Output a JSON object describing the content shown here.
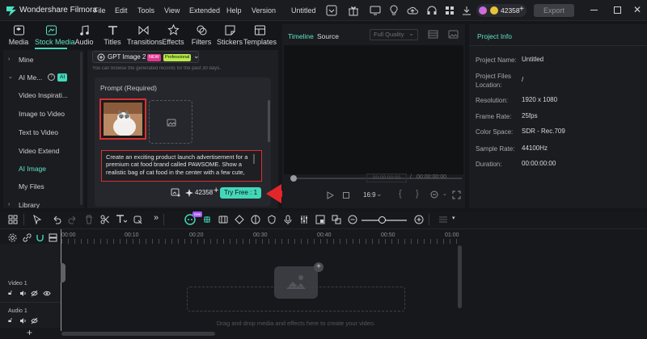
{
  "titlebar": {
    "app_name": "Wondershare Filmora",
    "menu": [
      "File",
      "Edit",
      "Tools",
      "View",
      "Extended",
      "Help",
      "Version"
    ],
    "project_title": "Untitled",
    "credits": "42358",
    "export_label": "Export"
  },
  "toolbar": {
    "items": [
      {
        "label": "Media",
        "icon": "media-icon"
      },
      {
        "label": "Stock Media",
        "icon": "stock-media-icon"
      },
      {
        "label": "Audio",
        "icon": "audio-icon"
      },
      {
        "label": "Titles",
        "icon": "titles-icon"
      },
      {
        "label": "Transitions",
        "icon": "transitions-icon"
      },
      {
        "label": "Effects",
        "icon": "effects-icon"
      },
      {
        "label": "Filters",
        "icon": "filters-icon"
      },
      {
        "label": "Stickers",
        "icon": "stickers-icon"
      },
      {
        "label": "Templates",
        "icon": "templates-icon"
      }
    ]
  },
  "sidebar": {
    "items": [
      {
        "label": "Mine"
      },
      {
        "label": "AI Me...",
        "badge": "AI"
      },
      {
        "label": "Video Inspirati..."
      },
      {
        "label": "Image to Video"
      },
      {
        "label": "Text to Video"
      },
      {
        "label": "Video Extend"
      },
      {
        "label": "AI Image"
      },
      {
        "label": "My Files"
      },
      {
        "label": "Library"
      }
    ]
  },
  "ai_panel": {
    "model_label": "GPT Image 2",
    "badge_new": "NEW",
    "badge_pro": "Professional",
    "notice": "You can browse the generated records for the past 30 days.",
    "prompt_heading": "Prompt (Required)",
    "prompt_text": "Create an exciting product launch advertisement for a premium cat food brand called PAWSOME. Show a realistic bag of cat food in the center with a few cute,",
    "credit_count": "42358",
    "try_free_label": "Try Free : 1"
  },
  "preview": {
    "tab_timeline": "Timeline",
    "tab_source": "Source",
    "quality": "Full Quality",
    "time_current": "00:00:00:00",
    "time_sep": "/",
    "time_total": "00:00:00:00",
    "aspect": "16:9"
  },
  "project_info": {
    "heading": "Project Info",
    "rows": [
      {
        "label": "Project Name:",
        "value": "Untitled"
      },
      {
        "label": "Project Files Location:",
        "value": "/"
      },
      {
        "label": "Resolution:",
        "value": "1920 x 1080"
      },
      {
        "label": "Frame Rate:",
        "value": "25fps"
      },
      {
        "label": "Color Space:",
        "value": "SDR - Rec.709"
      },
      {
        "label": "Sample Rate:",
        "value": "44100Hz"
      },
      {
        "label": "Duration:",
        "value": "00:00:00:00"
      }
    ]
  },
  "timeline": {
    "ruler": [
      "00:00",
      "00:10",
      "00:20",
      "00:30",
      "00:40",
      "00:50",
      "01:00"
    ],
    "tracks": [
      {
        "label": "Video 1"
      },
      {
        "label": "Audio 1"
      }
    ],
    "drop_hint": "Drag and drop media and effects here to create your video.",
    "ai_badge": "new"
  },
  "colors": {
    "accent": "#43d7b9",
    "arrow": "#e3262a",
    "highlight_border": "#d93030"
  }
}
